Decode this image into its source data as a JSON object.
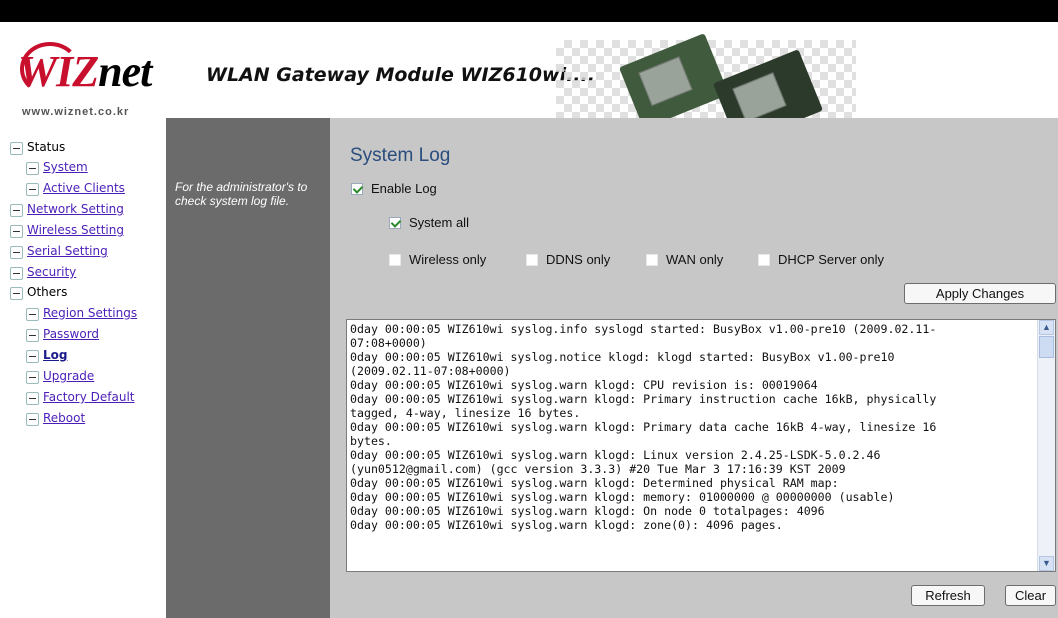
{
  "header": {
    "logo_text_red": "WIZ",
    "logo_text_black": "net",
    "logo_url": "www.wiznet.co.kr",
    "title": "WLAN Gateway Module WIZ610wi...."
  },
  "sidebar": {
    "items": [
      {
        "label": "Status",
        "link": false
      },
      {
        "label": "System",
        "link": true
      },
      {
        "label": "Active Clients",
        "link": true
      },
      {
        "label": "Network Setting",
        "link": true
      },
      {
        "label": "Wireless Setting",
        "link": true
      },
      {
        "label": "Serial Setting",
        "link": true
      },
      {
        "label": "Security",
        "link": true
      },
      {
        "label": "Others",
        "link": false
      },
      {
        "label": "Region Settings",
        "link": true
      },
      {
        "label": "Password",
        "link": true
      },
      {
        "label": "Log",
        "link": true
      },
      {
        "label": "Upgrade",
        "link": true
      },
      {
        "label": "Factory Default",
        "link": true
      },
      {
        "label": "Reboot",
        "link": true
      }
    ]
  },
  "description": "For the administrator's to check system log file.",
  "main": {
    "title": "System Log",
    "enable_log": {
      "label": "Enable Log",
      "checked": true
    },
    "system_all": {
      "label": "System all",
      "checked": true
    },
    "filters": [
      {
        "label": "Wireless only",
        "checked": false
      },
      {
        "label": "DDNS only",
        "checked": false
      },
      {
        "label": "WAN only",
        "checked": false
      },
      {
        "label": "DHCP Server only",
        "checked": false
      }
    ],
    "apply_label": "Apply Changes",
    "log_lines": [
      "0day 00:00:05 WIZ610wi syslog.info syslogd started: BusyBox v1.00-pre10 (2009.02.11-",
      "07:08+0000)",
      "0day 00:00:05 WIZ610wi syslog.notice klogd: klogd started: BusyBox v1.00-pre10",
      "(2009.02.11-07:08+0000)",
      "0day 00:00:05 WIZ610wi syslog.warn klogd: CPU revision is: 00019064",
      "0day 00:00:05 WIZ610wi syslog.warn klogd: Primary instruction cache 16kB, physically",
      "tagged, 4-way, linesize 16 bytes.",
      "0day 00:00:05 WIZ610wi syslog.warn klogd: Primary data cache 16kB 4-way, linesize 16",
      "bytes.",
      "0day 00:00:05 WIZ610wi syslog.warn klogd: Linux version 2.4.25-LSDK-5.0.2.46",
      "(yun0512@gmail.com) (gcc version 3.3.3) #20 Tue Mar 3 17:16:39 KST 2009",
      "0day 00:00:05 WIZ610wi syslog.warn klogd: Determined physical RAM map:",
      "0day 00:00:05 WIZ610wi syslog.warn klogd:  memory: 01000000 @ 00000000 (usable)",
      "0day 00:00:05 WIZ610wi syslog.warn klogd: On node 0 totalpages: 4096",
      "0day 00:00:05 WIZ610wi syslog.warn klogd: zone(0): 4096 pages."
    ],
    "refresh_label": "Refresh",
    "clear_label": "Clear"
  },
  "icons": {
    "tree_toggle": "minus-box-icon",
    "scroll_up": "chevron-up-icon",
    "scroll_down": "chevron-down-icon"
  },
  "colors": {
    "title": "#2a4d7d",
    "description_panel": "#6b6b6b",
    "content_panel": "#c7c7c7",
    "link": "#4b1eb8",
    "logo_red": "#c8102e"
  }
}
